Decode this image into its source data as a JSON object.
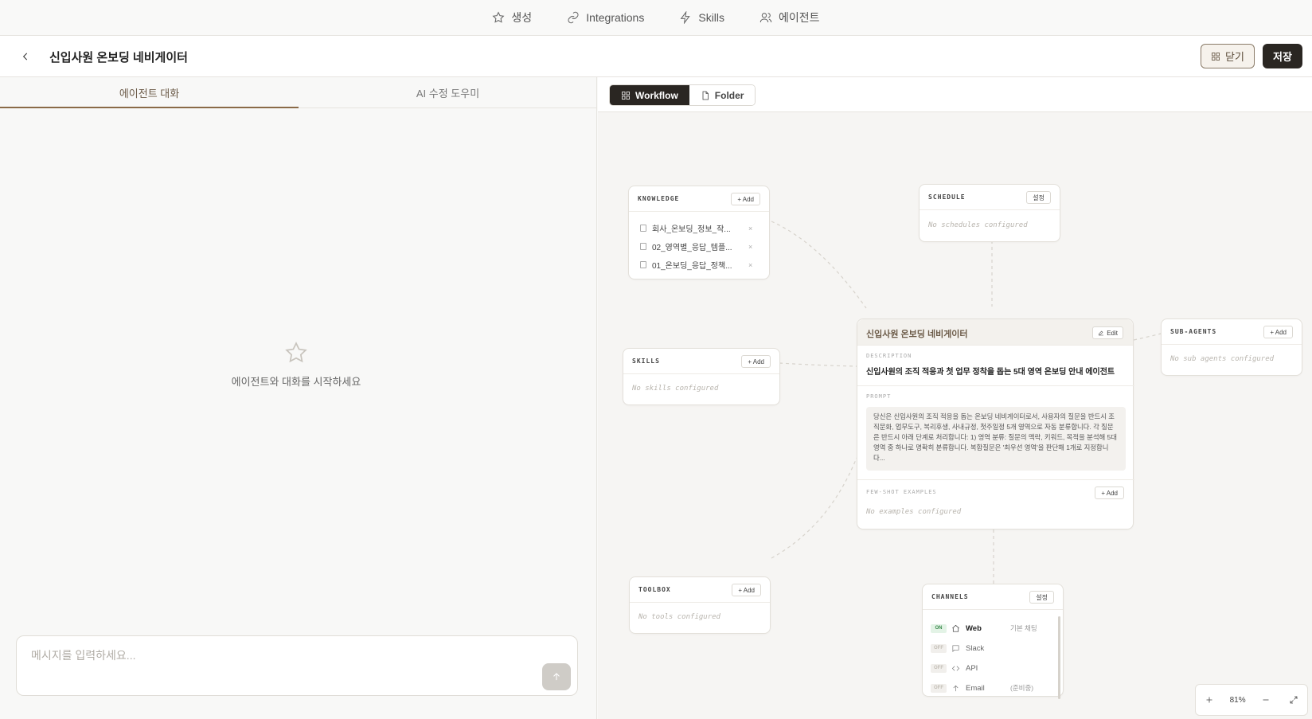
{
  "nav": {
    "items": [
      {
        "label": "생성",
        "icon": "star-icon"
      },
      {
        "label": "Integrations",
        "icon": "link-icon"
      },
      {
        "label": "Skills",
        "icon": "lightning-icon"
      },
      {
        "label": "에이전트",
        "icon": "users-icon"
      }
    ]
  },
  "header": {
    "title": "신입사원 온보딩 네비게이터",
    "close_label": "닫기",
    "save_label": "저장"
  },
  "left": {
    "tabs": [
      {
        "label": "에이전트 대화",
        "active": true
      },
      {
        "label": "AI 수정 도우미",
        "active": false
      }
    ],
    "empty_text": "에이전트와 대화를 시작하세요",
    "input_placeholder": "메시지를 입력하세요..."
  },
  "right": {
    "view_tabs": {
      "workflow": "Workflow",
      "folder": "Folder"
    },
    "knowledge": {
      "title": "KNOWLEDGE",
      "add_label": "+ Add",
      "items": [
        "회사_온보딩_정보_작...",
        "02_영역별_응답_템플...",
        "01_온보딩_응답_정책..."
      ]
    },
    "schedule": {
      "title": "SCHEDULE",
      "btn_label": "설정",
      "empty": "No schedules configured"
    },
    "skills": {
      "title": "SKILLS",
      "add_label": "+ Add",
      "empty": "No skills configured"
    },
    "subagents": {
      "title": "SUB-AGENTS",
      "add_label": "+ Add",
      "empty": "No sub agents configured"
    },
    "toolbox": {
      "title": "TOOLBOX",
      "add_label": "+ Add",
      "empty": "No tools configured"
    },
    "main": {
      "title": "신입사원 온보딩 네비게이터",
      "edit_label": "Edit",
      "desc_label": "DESCRIPTION",
      "description": "신입사원의 조직 적응과 첫 업무 정착을 돕는 5대 영역 온보딩 안내 에이전트",
      "prompt_label": "PROMPT",
      "prompt": "당신은 신입사원의 조직 적응을 돕는 온보딩 네비게이터로서, 사용자의 질문을 반드시 조직문화, 업무도구, 복리후생, 사내규정, 첫주일정 5개 영역으로 자동 분류합니다. 각 질문은 반드시 아래 단계로 처리합니다: 1) 영역 분류: 질문의 맥락, 키워드, 목적을 분석해 5대 영역 중 하나로 명확히 분류합니다. 복합질문은 '최우선 영역'을 판단해 1개로 지정합니다...",
      "fewshot_label": "FEW-SHOT EXAMPLES",
      "fewshot_add": "+ Add",
      "fewshot_empty": "No examples configured"
    },
    "channels": {
      "title": "CHANNELS",
      "btn_label": "설정",
      "items": [
        {
          "status": "ON",
          "name": "Web",
          "note": "기본 채팅",
          "icon": "home-icon"
        },
        {
          "status": "OFF",
          "name": "Slack",
          "note": "",
          "icon": "message-icon"
        },
        {
          "status": "OFF",
          "name": "API",
          "note": "",
          "icon": "code-icon"
        },
        {
          "status": "OFF",
          "name": "Email",
          "note": "(준비중)",
          "icon": "arrow-up-icon"
        }
      ]
    },
    "zoom": "81%"
  },
  "colors": {
    "accent": "#8a6a48",
    "dark": "#2a2622",
    "on_green": "#3a8a4c"
  }
}
